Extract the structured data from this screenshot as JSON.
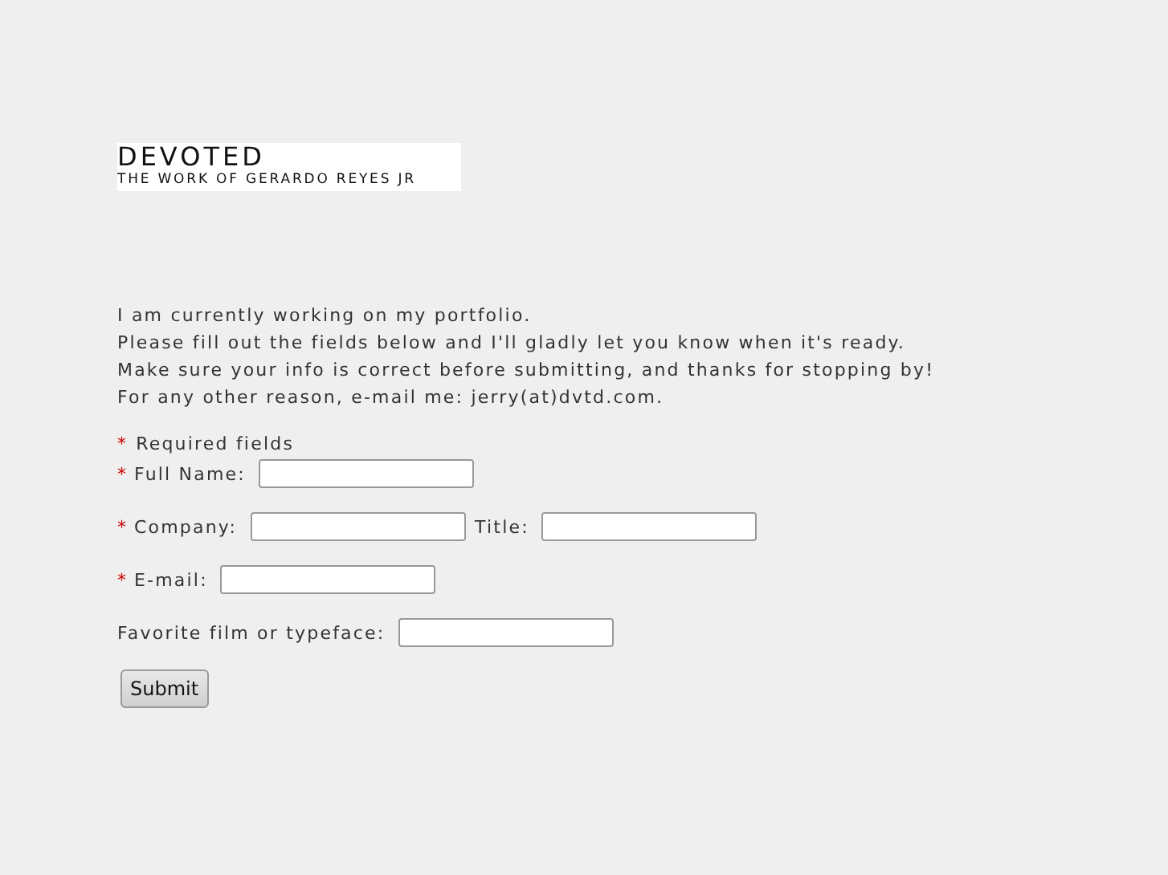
{
  "logo": {
    "title": "DEVOTED",
    "subtitle": "THE WORK OF GERARDO REYES JR"
  },
  "intro": [
    "I am currently working on my portfolio.",
    "Please fill out the fields below and I'll gladly let you know when it's ready.",
    "Make sure your info is correct before submitting, and thanks for stopping by!",
    "For any other reason, e-mail me: jerry(at)dvtd.com."
  ],
  "legend": {
    "mark": "*",
    "text": "Required fields"
  },
  "rows": [
    [
      {
        "mark": "*",
        "label": "Full Name:"
      }
    ],
    [
      {
        "mark": "*",
        "label": "Company:"
      },
      {
        "label": "Title:"
      }
    ],
    [
      {
        "mark": "*",
        "label": "E-mail:"
      }
    ],
    [
      {
        "label": "Favorite film or typeface:"
      }
    ]
  ],
  "submit": "Submit"
}
